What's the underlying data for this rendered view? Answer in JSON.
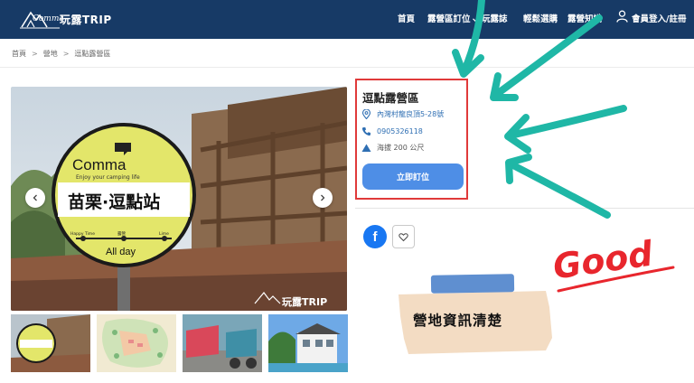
{
  "header": {
    "logo_text": "玩露TRIP",
    "logo_script": "Comma",
    "nav": [
      {
        "label": "首頁"
      },
      {
        "label": "露營區訂位"
      },
      {
        "label": "玩露誌"
      },
      {
        "label": "輕鬆選購"
      },
      {
        "label": "露營知識"
      },
      {
        "label": "會員登入/註冊"
      }
    ]
  },
  "breadcrumb": [
    "首頁",
    "營地",
    "逗點露營區"
  ],
  "gallery": {
    "sign_brand": "Comma",
    "sign_tagline": "Enjoy your camping life",
    "sign_main": "苗栗·逗點站",
    "sign_scale": [
      "Happy Time",
      "露營",
      "Lime"
    ],
    "sign_allday": "All day",
    "watermark": "玩露TRIP"
  },
  "campsite": {
    "name": "逗點露營區",
    "address": "內灣村龍良頂5-28號",
    "phone": "0905326118",
    "altitude": "海拔 200 公尺",
    "book_label": "立即訂位"
  },
  "annotations": {
    "good": "Good",
    "note": "營地資訊清楚"
  },
  "colors": {
    "header_bg": "#173a66",
    "button_blue": "#4e8ee6",
    "highlight_red": "#e03a3a",
    "arrow_teal": "#1fb7a6",
    "good_red": "#e8262d",
    "facebook": "#1877f2"
  }
}
